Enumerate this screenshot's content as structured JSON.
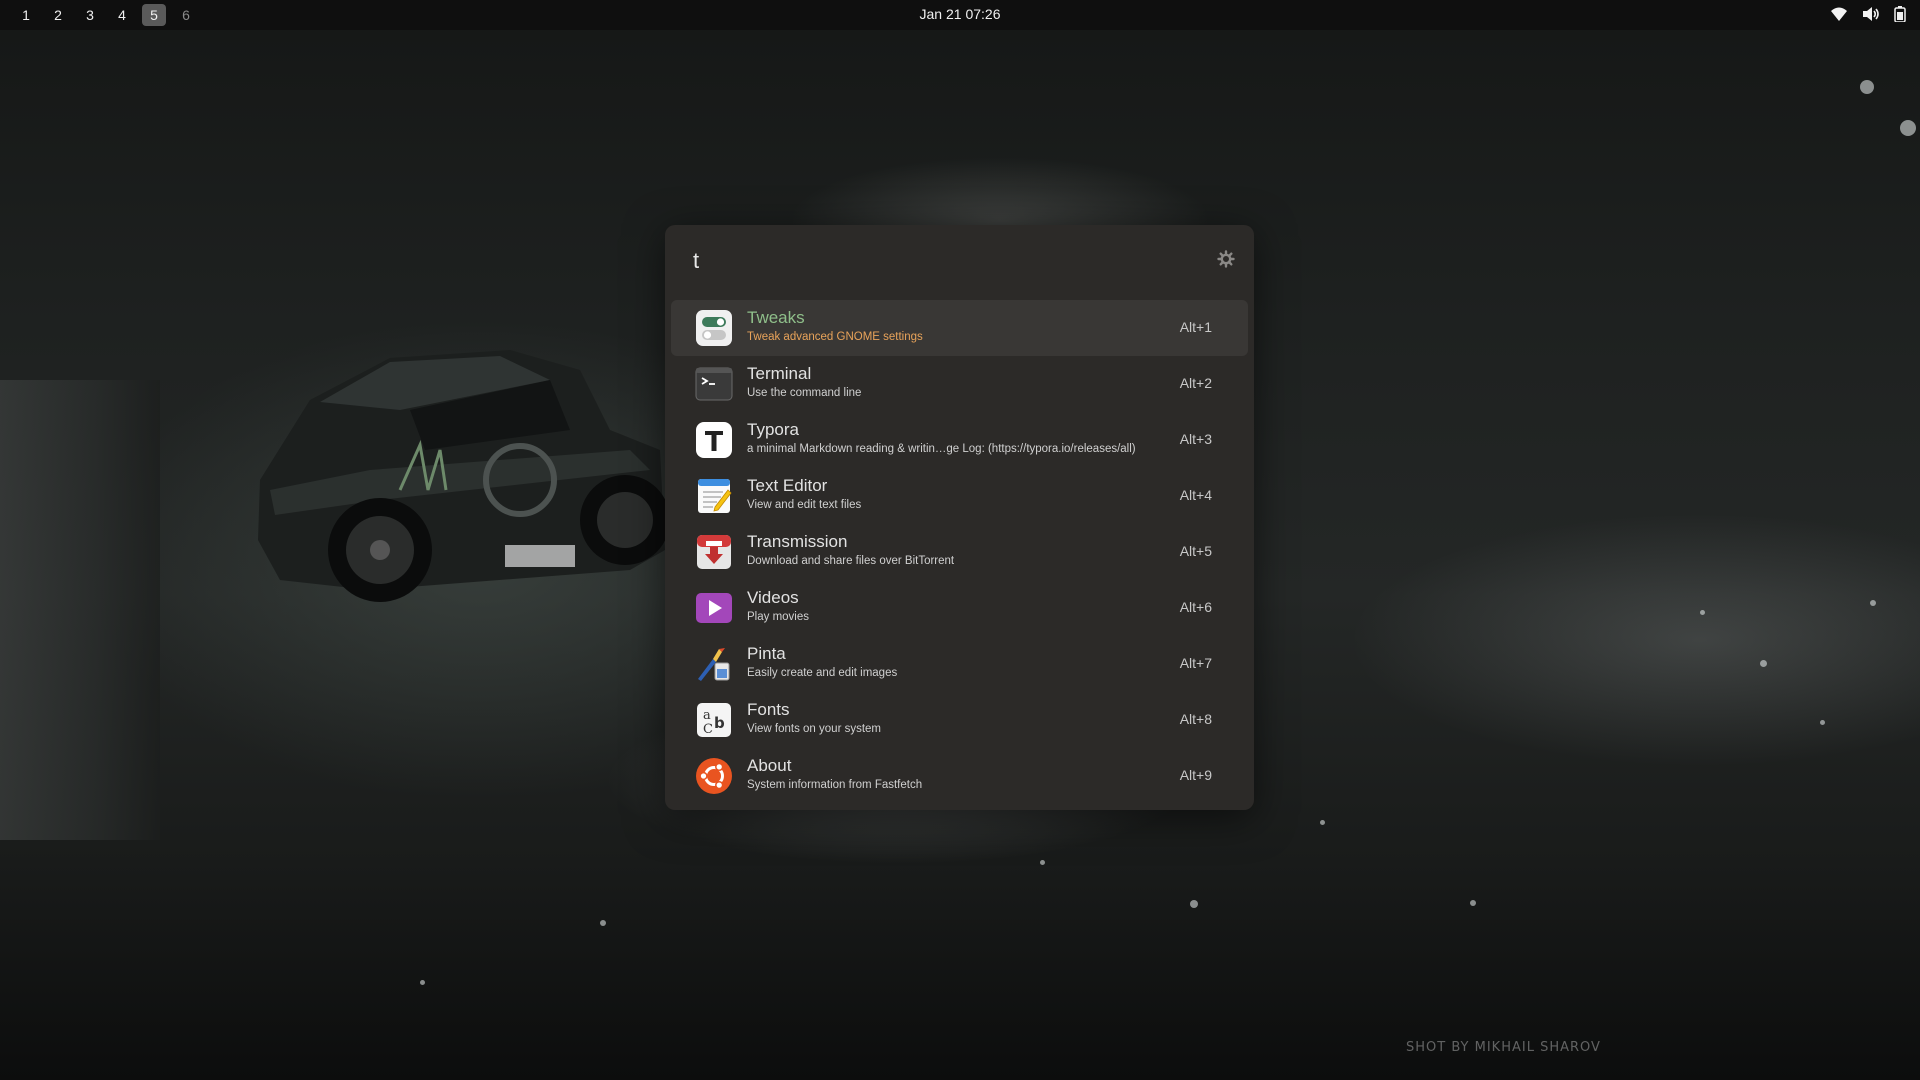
{
  "topbar": {
    "workspaces": [
      {
        "label": "1",
        "state": "occupied"
      },
      {
        "label": "2",
        "state": "occupied"
      },
      {
        "label": "3",
        "state": "occupied"
      },
      {
        "label": "4",
        "state": "occupied"
      },
      {
        "label": "5",
        "state": "active"
      },
      {
        "label": "6",
        "state": "empty"
      }
    ],
    "clock": "Jan 21  07:26",
    "tray_icons": [
      "wifi-icon",
      "volume-icon",
      "battery-icon"
    ]
  },
  "launcher": {
    "query": "t",
    "settings_icon": "gear-icon",
    "selected_index": 0,
    "results": [
      {
        "name": "Tweaks",
        "description": "Tweak advanced GNOME settings",
        "shortcut": "Alt+1",
        "icon": "tweaks-icon"
      },
      {
        "name": "Terminal",
        "description": "Use the command line",
        "shortcut": "Alt+2",
        "icon": "terminal-icon"
      },
      {
        "name": "Typora",
        "description": "a minimal Markdown reading & writin…ge Log: (https://typora.io/releases/all)",
        "shortcut": "Alt+3",
        "icon": "typora-icon"
      },
      {
        "name": "Text Editor",
        "description": "View and edit text files",
        "shortcut": "Alt+4",
        "icon": "text-editor-icon"
      },
      {
        "name": "Transmission",
        "description": "Download and share files over BitTorrent",
        "shortcut": "Alt+5",
        "icon": "transmission-icon"
      },
      {
        "name": "Videos",
        "description": "Play movies",
        "shortcut": "Alt+6",
        "icon": "videos-icon"
      },
      {
        "name": "Pinta",
        "description": "Easily create and edit images",
        "shortcut": "Alt+7",
        "icon": "pinta-icon"
      },
      {
        "name": "Fonts",
        "description": "View fonts on your system",
        "shortcut": "Alt+8",
        "icon": "fonts-icon"
      },
      {
        "name": "About",
        "description": "System information from Fastfetch",
        "shortcut": "Alt+9",
        "icon": "ubuntu-logo-icon"
      }
    ]
  },
  "wallpaper": {
    "credit": "SHOT BY MIKHAIL SHAROV"
  },
  "colors": {
    "topbar_bg": "#0f0f0f",
    "launcher_bg": "#2c2a28",
    "selected_row_bg": "#393735",
    "selected_name": "#8fbf8a",
    "selected_desc": "#e8a35a"
  }
}
